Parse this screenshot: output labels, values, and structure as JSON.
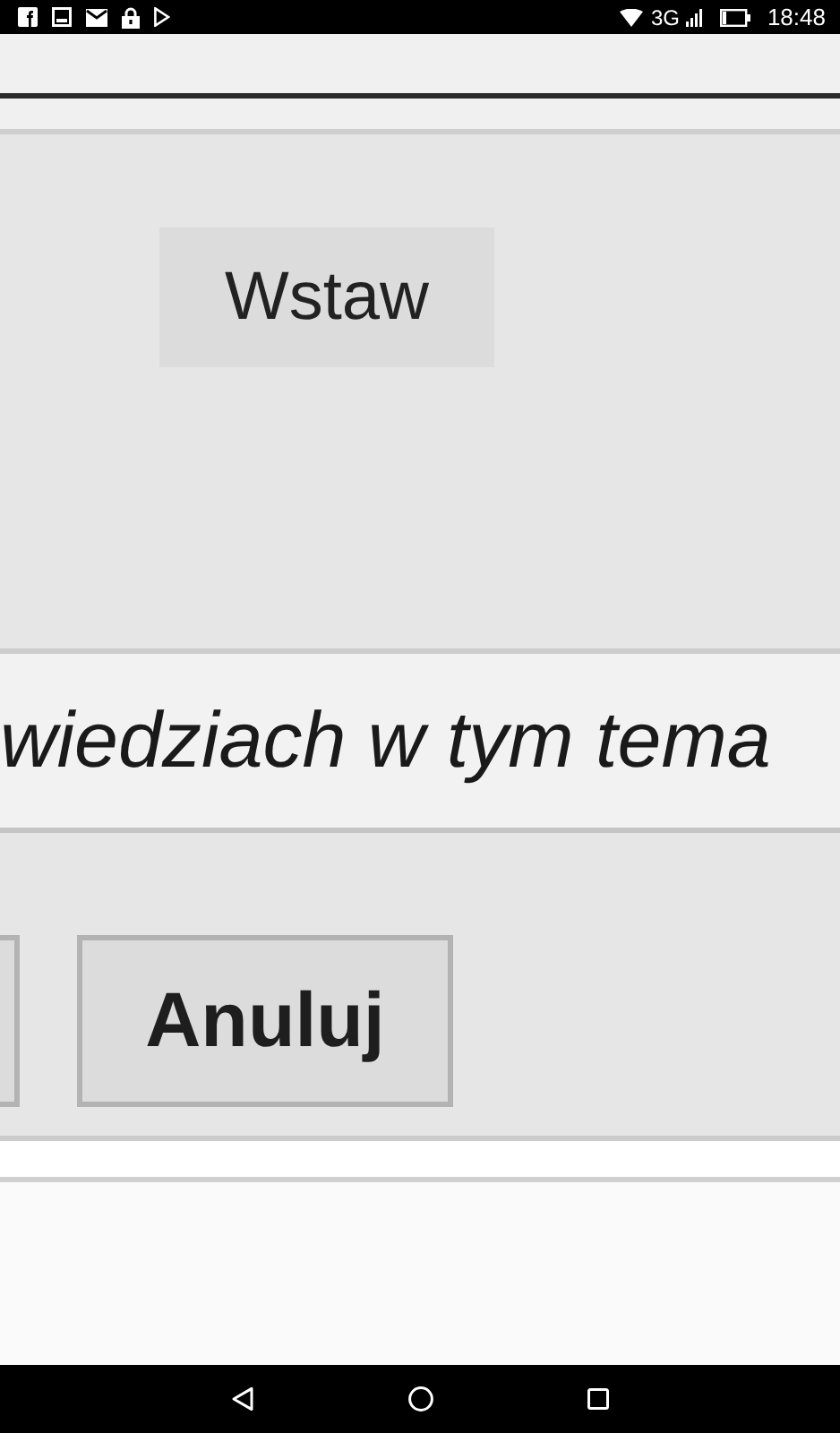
{
  "status_bar": {
    "network": "3G",
    "time": "18:48"
  },
  "insert_button": {
    "label": "Wstaw"
  },
  "text_line": "wiedziach w tym tema",
  "cancel_button": {
    "label": "Anuluj"
  }
}
